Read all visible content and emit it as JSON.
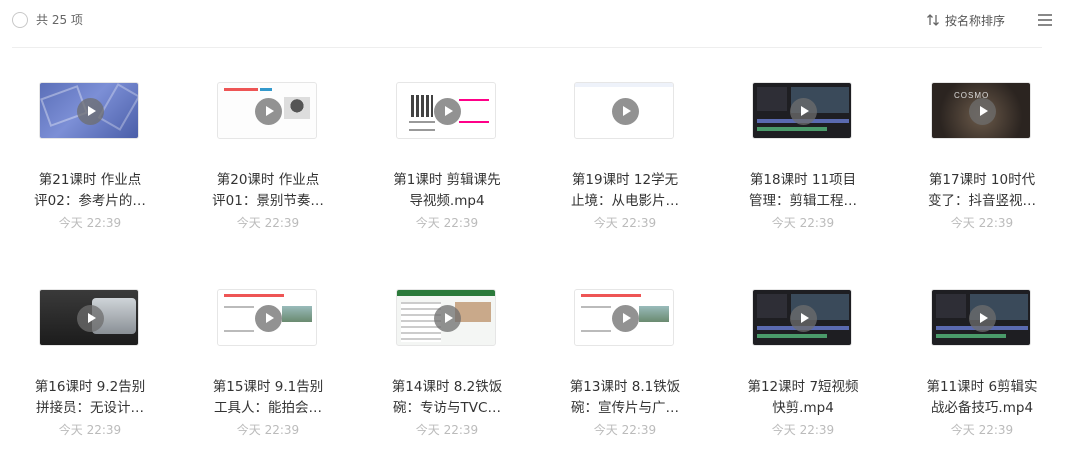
{
  "header": {
    "count_label": "共 25 项",
    "sort_label": "按名称排序"
  },
  "items": [
    {
      "title_line1": "第21课时 作业点",
      "title_line2": "评02：参考片的…",
      "time": "今天 22:39",
      "thumb": "blue"
    },
    {
      "title_line1": "第20课时 作业点",
      "title_line2": "评01：景别节奏…",
      "time": "今天 22:39",
      "thumb": "white"
    },
    {
      "title_line1": "第1课时 剪辑课先",
      "title_line2": "导视频.mp4",
      "time": "今天 22:39",
      "thumb": "qr"
    },
    {
      "title_line1": "第19课时 12学无",
      "title_line2": "止境：从电影片…",
      "time": "今天 22:39",
      "thumb": "blank"
    },
    {
      "title_line1": "第18课时 11项目",
      "title_line2": "管理：剪辑工程…",
      "time": "今天 22:39",
      "thumb": "dark"
    },
    {
      "title_line1": "第17课时 10时代",
      "title_line2": "变了：抖音竖视…",
      "time": "今天 22:39",
      "thumb": "stage"
    },
    {
      "title_line1": "第16课时 9.2告别",
      "title_line2": "拼接员：无设计…",
      "time": "今天 22:39",
      "thumb": "car"
    },
    {
      "title_line1": "第15课时 9.1告别",
      "title_line2": "工具人：能拍会…",
      "time": "今天 22:39",
      "thumb": "slide"
    },
    {
      "title_line1": "第14课时 8.2铁饭",
      "title_line2": "碗：专访与TVC…",
      "time": "今天 22:39",
      "thumb": "doc"
    },
    {
      "title_line1": "第13课时 8.1铁饭",
      "title_line2": "碗：宣传片与广…",
      "time": "今天 22:39",
      "thumb": "slide"
    },
    {
      "title_line1": "第12课时 7短视频",
      "title_line2": "快剪.mp4",
      "time": "今天 22:39",
      "thumb": "dark"
    },
    {
      "title_line1": "第11课时 6剪辑实",
      "title_line2": "战必备技巧.mp4",
      "time": "今天 22:39",
      "thumb": "dark"
    }
  ],
  "thumb_texts": {
    "stage_logo": "COSMO"
  }
}
